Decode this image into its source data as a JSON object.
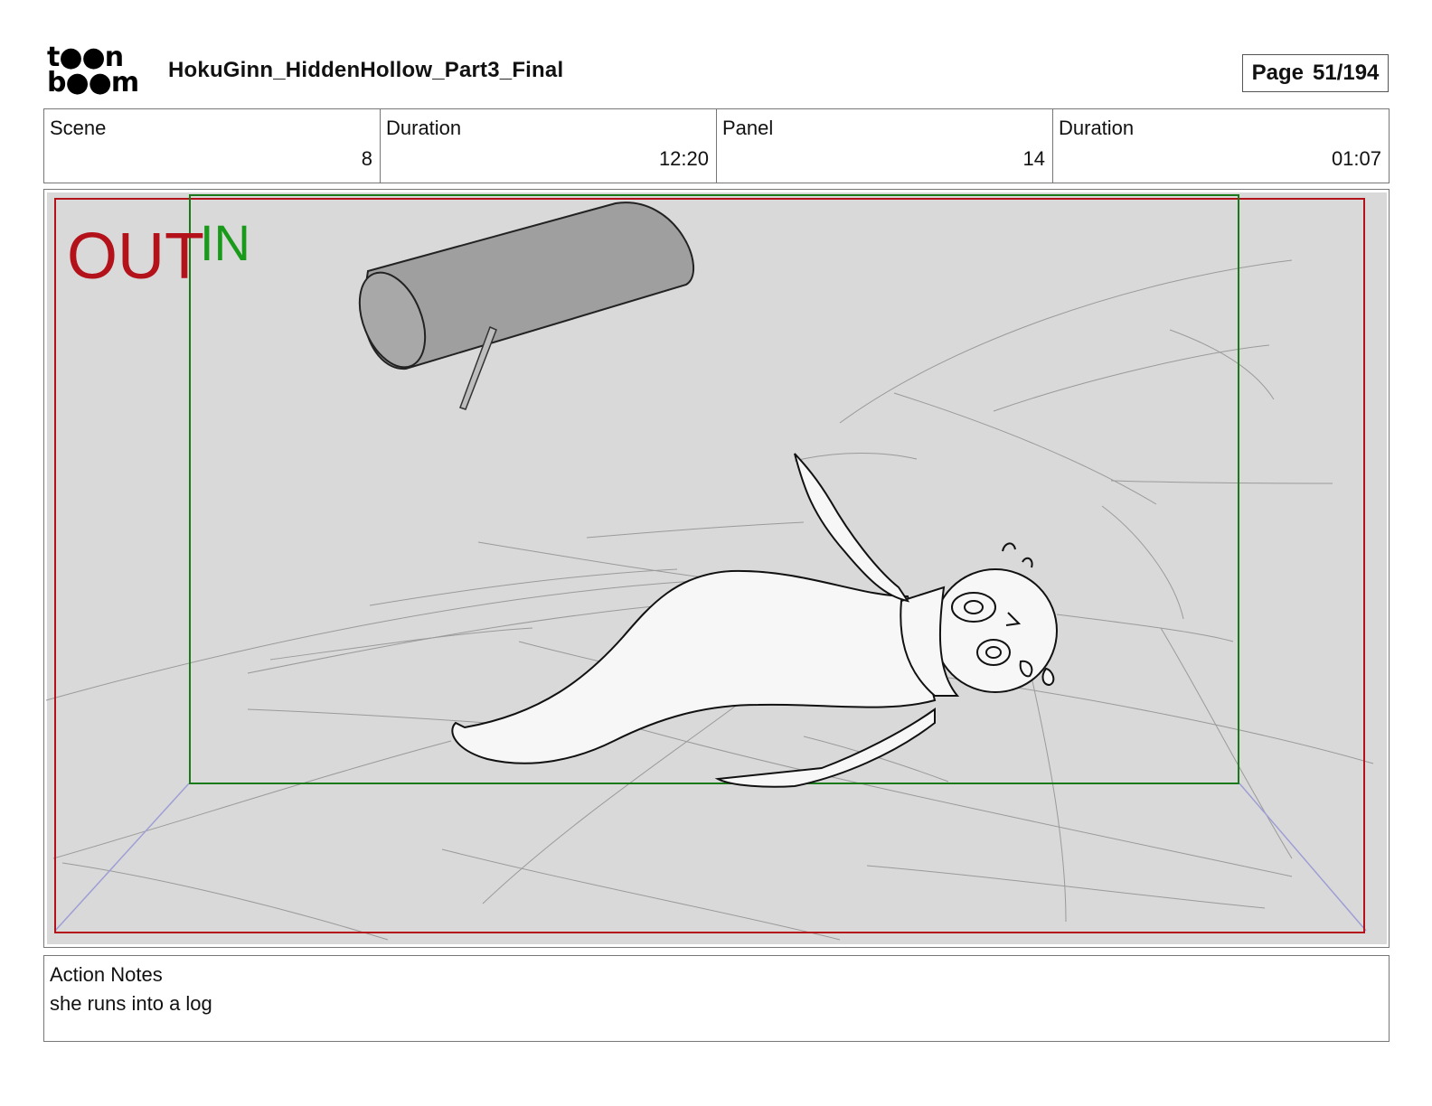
{
  "header": {
    "logo_top": "t●●n",
    "logo_bottom": "b●●m",
    "title": "HokuGinn_HiddenHollow_Part3_Final",
    "page_label": "Page",
    "page_value": "51/194"
  },
  "info": {
    "scene_label": "Scene",
    "scene_value": "8",
    "scene_duration_label": "Duration",
    "scene_duration_value": "12:20",
    "panel_label": "Panel",
    "panel_value": "14",
    "panel_duration_label": "Duration",
    "panel_duration_value": "01:07"
  },
  "panel": {
    "out_label": "OUT",
    "in_label": "IN",
    "out_color": "#b3121b",
    "in_color": "#1a9a1a"
  },
  "notes": {
    "label": "Action Notes",
    "text": "she runs into a log"
  }
}
